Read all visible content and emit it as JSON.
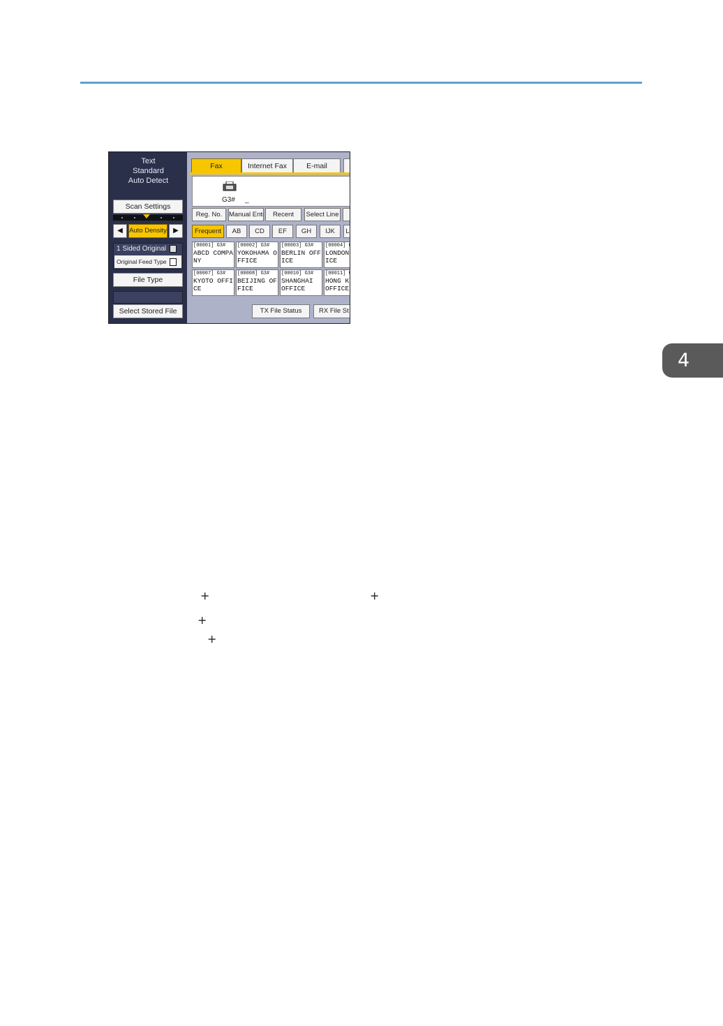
{
  "chapter": {
    "number": "4"
  },
  "screen": {
    "left_panel": {
      "info_lines": [
        "Text",
        "Standard",
        "Auto Detect"
      ],
      "scan_settings": "Scan Settings",
      "density_left": "◀",
      "auto_density": "Auto Density",
      "density_right": "▶",
      "original_top": "1 Sided Original",
      "original_feed": "Original Feed Type",
      "file_type": "File Type",
      "select_stored_file": "Select Stored File"
    },
    "tabs": [
      {
        "label": "Fax",
        "active": true
      },
      {
        "label": "Internet Fax",
        "active": false
      },
      {
        "label": "E-mail",
        "active": false
      }
    ],
    "destination": {
      "line_label": "G3#",
      "cursor": "_"
    },
    "buttons": [
      "Reg. No.",
      "Manual Entry",
      "Recent",
      "Select Line"
    ],
    "index_tabs": [
      "Frequent",
      "AB",
      "CD",
      "EF",
      "GH",
      "IJK",
      "L"
    ],
    "entries": [
      {
        "id": "[00001] G3#",
        "name": "ABCD COMPA\nNY"
      },
      {
        "id": "[00002] G3#",
        "name": "YOKOHAMA O\nFFICE"
      },
      {
        "id": "[00003] G3#",
        "name": "BERLIN OFF\nICE"
      },
      {
        "id": "[00004] G",
        "name": "LONDON\nICE"
      },
      {
        "id": "[00007] G3#",
        "name": "KYOTO OFFI\nCE"
      },
      {
        "id": "[00008] G3#",
        "name": "BEIJING OF\nFICE"
      },
      {
        "id": "[00010] G3#",
        "name": "SHANGHAI\nOFFICE"
      },
      {
        "id": "[00011] G",
        "name": "HONG K\nOFFICE"
      }
    ],
    "bottom_buttons": [
      "TX File Status",
      "RX File St"
    ]
  },
  "plus_signs": [
    "+",
    "+",
    "+",
    "+"
  ]
}
